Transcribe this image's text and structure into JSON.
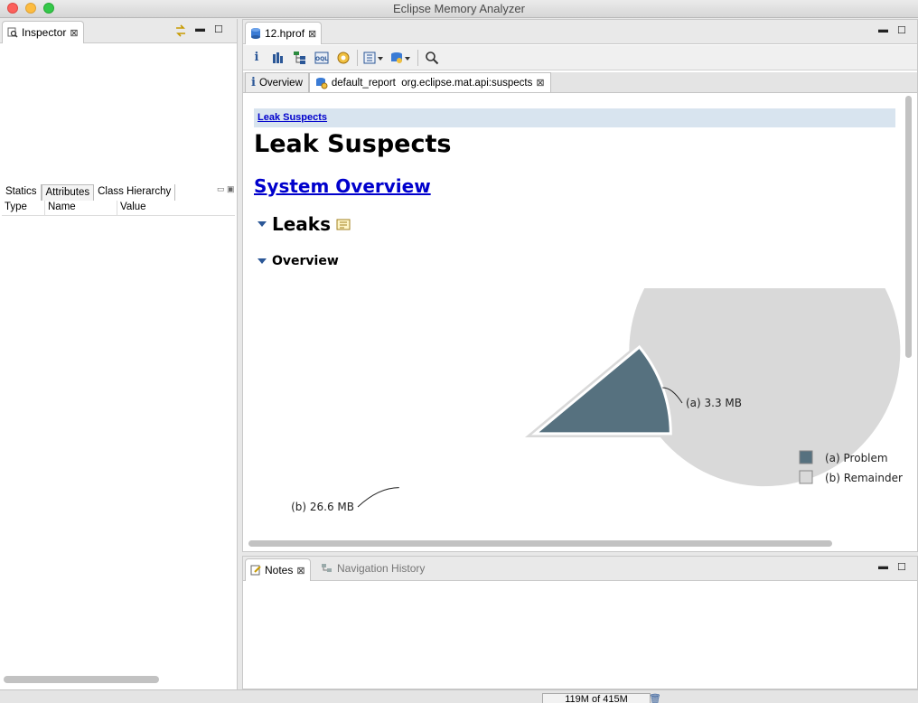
{
  "window": {
    "title": "Eclipse Memory Analyzer"
  },
  "inspector": {
    "tab_label": "Inspector",
    "sub_tabs": [
      "Statics",
      "Attributes",
      "Class Hierarchy"
    ],
    "columns": [
      "Type",
      "Name",
      "Value"
    ]
  },
  "editor": {
    "tab_label": "12.hprof",
    "toolbar_icons": [
      "info-icon",
      "histogram-icon",
      "dominator-tree-icon",
      "oql-icon",
      "thread-overview-icon",
      "run-report-icon",
      "query-browser-icon",
      "search-icon"
    ],
    "inner_tabs": [
      {
        "label": "Overview",
        "icon": "info-icon"
      },
      {
        "label": "default_report  org.eclipse.mat.api:suspects",
        "icon": "report-icon"
      }
    ],
    "report": {
      "breadcrumb": "Leak Suspects",
      "title": "Leak Suspects",
      "system_overview_link": "System Overview",
      "leaks_heading": "Leaks",
      "overview_heading": "Overview"
    }
  },
  "chart_data": {
    "type": "pie",
    "slices": [
      {
        "label": "(a)  3.3 MB",
        "legend": "(a)  Problem",
        "value": 3.3,
        "color": "#56717f"
      },
      {
        "label": "(b)  26.6 MB",
        "legend": "(b)  Remainder",
        "value": 26.6,
        "color": "#d9d9d9"
      }
    ],
    "units": "MB"
  },
  "notes": {
    "tab_label": "Notes",
    "nav_history_label": "Navigation History"
  },
  "status": {
    "heap_text": "119M of 415M"
  }
}
